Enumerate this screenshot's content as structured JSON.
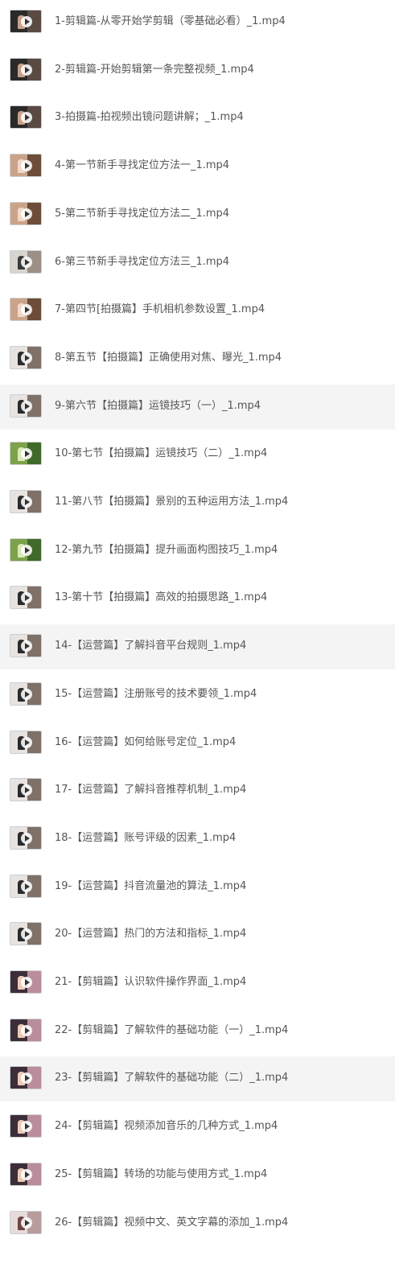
{
  "files": [
    {
      "name": "1-剪辑篇-从零开始学剪辑（零基础必看）_1.mp4",
      "thumb_style": "dark",
      "highlighted": false
    },
    {
      "name": "2-剪辑篇-开始剪辑第一条完整视频_1.mp4",
      "thumb_style": "dark",
      "highlighted": false
    },
    {
      "name": "3-拍摄篇-拍视频出镜问题讲解；_1.mp4",
      "thumb_style": "dark",
      "highlighted": false
    },
    {
      "name": "4-第一节新手寻找定位方法一_1.mp4",
      "thumb_style": "warm",
      "highlighted": false
    },
    {
      "name": "5-第二节新手寻找定位方法二_1.mp4",
      "thumb_style": "warm",
      "highlighted": false
    },
    {
      "name": "6-第三节新手寻找定位方法三_1.mp4",
      "thumb_style": "light",
      "highlighted": false
    },
    {
      "name": "7-第四节[拍摄篇】手机相机参数设置_1.mp4",
      "thumb_style": "warm",
      "highlighted": false
    },
    {
      "name": "8-第五节【拍摄篇】正确使用对焦、曝光_1.mp4",
      "thumb_style": "studio",
      "highlighted": false
    },
    {
      "name": "9-第六节【拍摄篇】运镜技巧（一）_1.mp4",
      "thumb_style": "studio",
      "highlighted": true
    },
    {
      "name": "10-第七节【拍摄篇】运镜技巧（二）_1.mp4",
      "thumb_style": "green",
      "highlighted": false
    },
    {
      "name": "11-第八节【拍摄篇】景别的五种运用方法_1.mp4",
      "thumb_style": "studio",
      "highlighted": false
    },
    {
      "name": "12-第九节【拍摄篇】提升画面构图技巧_1.mp4",
      "thumb_style": "green",
      "highlighted": false
    },
    {
      "name": "13-第十节【拍摄篇】高效的拍摄思路_1.mp4",
      "thumb_style": "studio",
      "highlighted": false
    },
    {
      "name": "14-【运营篇】了解抖音平台规则_1.mp4",
      "thumb_style": "studio",
      "highlighted": true
    },
    {
      "name": "15-【运营篇】注册账号的技术要领_1.mp4",
      "thumb_style": "studio",
      "highlighted": false
    },
    {
      "name": "16-【运营篇】如何给账号定位_1.mp4",
      "thumb_style": "studio",
      "highlighted": false
    },
    {
      "name": "17-【运营篇】了解抖音推荐机制_1.mp4",
      "thumb_style": "studio",
      "highlighted": false
    },
    {
      "name": "18-【运营篇】账号评级的因素_1.mp4",
      "thumb_style": "studio",
      "highlighted": false
    },
    {
      "name": "19-【运营篇】抖音流量池的算法_1.mp4",
      "thumb_style": "studio",
      "highlighted": false
    },
    {
      "name": "20-【运营篇】热门的方法和指标_1.mp4",
      "thumb_style": "studio",
      "highlighted": false
    },
    {
      "name": "21-【剪辑篇】认识软件操作界面_1.mp4",
      "thumb_style": "screen",
      "highlighted": false
    },
    {
      "name": "22-【剪辑篇】了解软件的基础功能（一）_1.mp4",
      "thumb_style": "screen",
      "highlighted": false
    },
    {
      "name": "23-【剪辑篇】了解软件的基础功能（二）_1.mp4",
      "thumb_style": "screen",
      "highlighted": true
    },
    {
      "name": "24-【剪辑篇】视频添加音乐的几种方式_1.mp4",
      "thumb_style": "screen",
      "highlighted": false
    },
    {
      "name": "25-【剪辑篇】转场的功能与使用方式_1.mp4",
      "thumb_style": "screen",
      "highlighted": false
    },
    {
      "name": "26-【剪辑篇】视频中文、英文字幕的添加_1.mp4",
      "thumb_style": "pink",
      "highlighted": false
    }
  ],
  "colors": {
    "text": "#555555",
    "highlight_row": "#f4f4f4",
    "background": "#ffffff"
  },
  "icons": {
    "thumbnail_overlay": "play-icon"
  }
}
